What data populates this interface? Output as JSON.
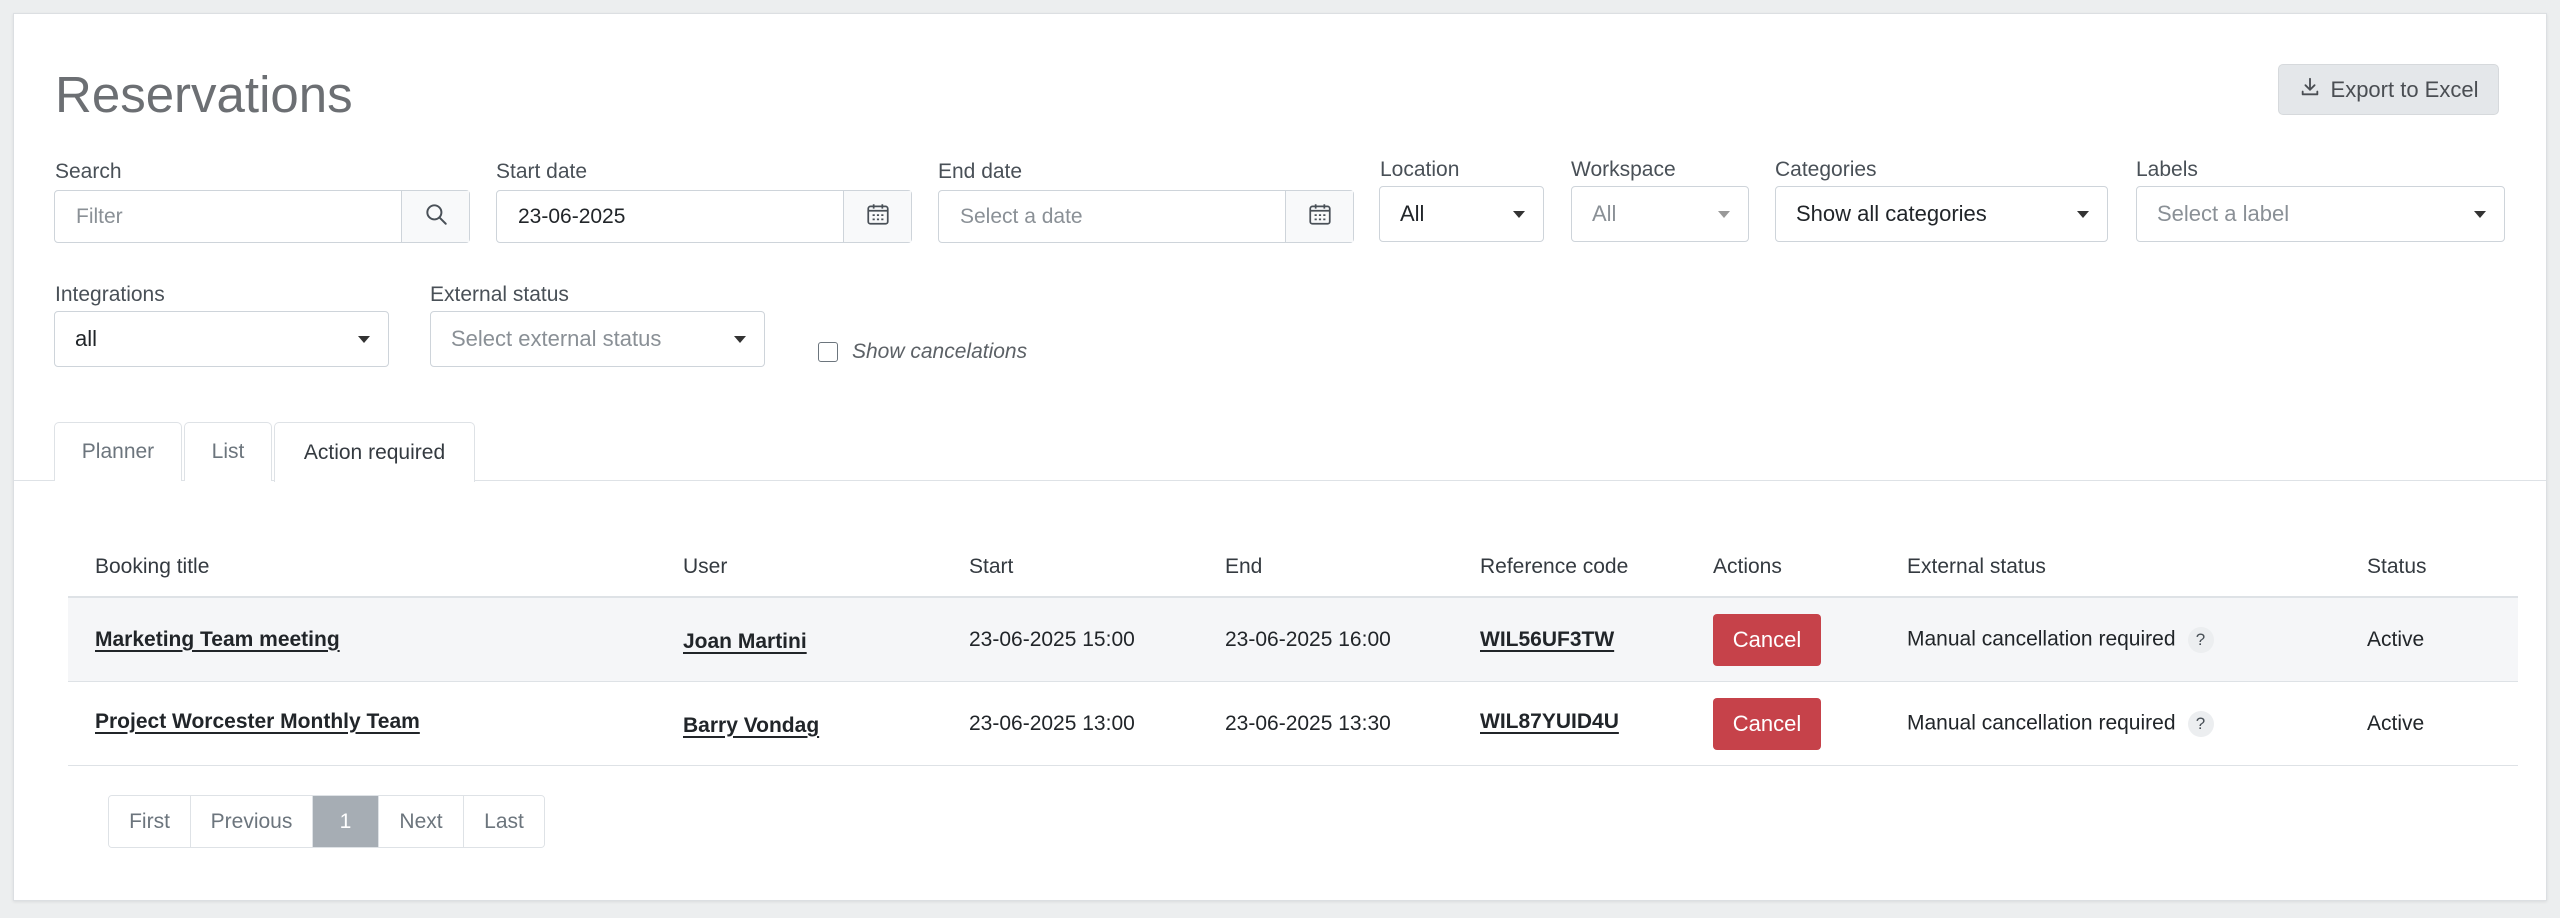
{
  "page": {
    "title": "Reservations"
  },
  "header": {
    "export_label": "Export to Excel",
    "export_icon": "download-icon"
  },
  "filters": {
    "search": {
      "label": "Search",
      "placeholder": "Filter",
      "icon": "search-icon"
    },
    "start_date": {
      "label": "Start date",
      "value": "23-06-2025",
      "icon": "calendar-icon"
    },
    "end_date": {
      "label": "End date",
      "placeholder": "Select a date",
      "icon": "calendar-icon"
    },
    "location": {
      "label": "Location",
      "value": "All"
    },
    "workspace": {
      "label": "Workspace",
      "value": "All"
    },
    "categories": {
      "label": "Categories",
      "value": "Show all categories"
    },
    "labels": {
      "label": "Labels",
      "placeholder": "Select a label"
    },
    "integrations": {
      "label": "Integrations",
      "value": "all"
    },
    "external_status": {
      "label": "External status",
      "placeholder": "Select external status"
    },
    "show_cancelations": {
      "label": "Show cancelations",
      "checked": false
    }
  },
  "tabs": [
    {
      "label": "Planner",
      "active": false
    },
    {
      "label": "List",
      "active": false
    },
    {
      "label": "Action required",
      "active": true
    }
  ],
  "table": {
    "columns": [
      "Booking title",
      "User",
      "Start",
      "End",
      "Reference code",
      "Actions",
      "External status",
      "Status"
    ],
    "rows": [
      {
        "title": "Marketing Team meeting",
        "user": "Joan Martini",
        "start": "23-06-2025 15:00",
        "end": "23-06-2025 16:00",
        "reference": "WIL56UF3TW",
        "action": "Cancel",
        "external_status": "Manual cancellation required",
        "help": "?",
        "status": "Active"
      },
      {
        "title": "Project Worcester Monthly Team",
        "user": "Barry Vondag",
        "start": "23-06-2025 13:00",
        "end": "23-06-2025 13:30",
        "reference": "WIL87YUID4U",
        "action": "Cancel",
        "external_status": "Manual cancellation required",
        "help": "?",
        "status": "Active"
      }
    ]
  },
  "pagination": {
    "first": "First",
    "previous": "Previous",
    "current": "1",
    "next": "Next",
    "last": "Last"
  },
  "colors": {
    "danger": "#c6424a",
    "active_page": "#a6adb4",
    "title": "#6c6f73"
  }
}
